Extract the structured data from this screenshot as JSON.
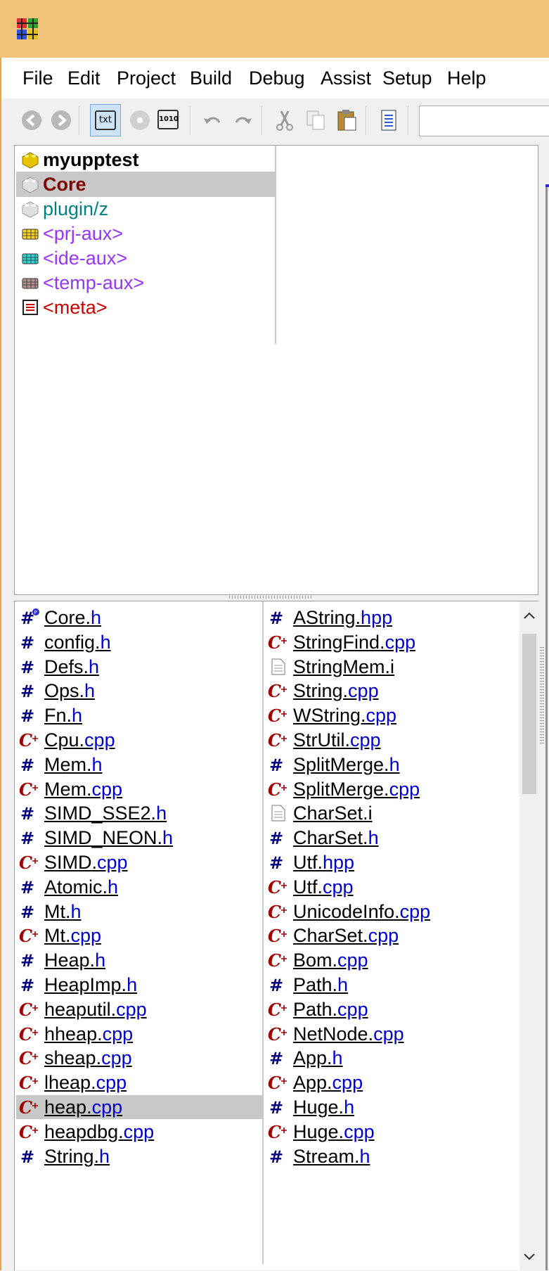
{
  "menu": [
    "File",
    "Edit",
    "Project",
    "Build",
    "Debug",
    "Assist",
    "Setup",
    "Help"
  ],
  "toolbar": {
    "icons": [
      "back-icon",
      "forward-icon",
      "txt-mode-icon",
      "cd-icon",
      "binary-mode-icon",
      "undo-icon",
      "redo-icon",
      "cut-icon",
      "copy-icon",
      "paste-icon",
      "document-icon"
    ],
    "txt_label": "txt",
    "bin_label": "1010"
  },
  "packages": [
    {
      "name": "myupptest",
      "kind": "main",
      "color": "#000000",
      "bold": true
    },
    {
      "name": "Core",
      "kind": "package",
      "color": "#800000",
      "bold": true,
      "selected": true
    },
    {
      "name": "plugin/z",
      "kind": "package",
      "color": "#008080",
      "bold": false
    },
    {
      "name": "<prj-aux>",
      "kind": "prj-aux",
      "color": "#9933ff",
      "bold": false
    },
    {
      "name": "<ide-aux>",
      "kind": "ide-aux",
      "color": "#9933ff",
      "bold": false
    },
    {
      "name": "<temp-aux>",
      "kind": "temp-aux",
      "color": "#9933ff",
      "bold": false
    },
    {
      "name": "<meta>",
      "kind": "meta",
      "color": "#cc0000",
      "bold": false
    }
  ],
  "files_left": [
    {
      "base": "Core.",
      "ext": "h",
      "icon": "header-main"
    },
    {
      "base": "config.",
      "ext": "h",
      "icon": "header"
    },
    {
      "base": "Defs.",
      "ext": "h",
      "icon": "header"
    },
    {
      "base": "Ops.",
      "ext": "h",
      "icon": "header"
    },
    {
      "base": "Fn.",
      "ext": "h",
      "icon": "header"
    },
    {
      "base": "Cpu.",
      "ext": "cpp",
      "icon": "cpp"
    },
    {
      "base": "Mem.",
      "ext": "h",
      "icon": "header"
    },
    {
      "base": "Mem.",
      "ext": "cpp",
      "icon": "cpp"
    },
    {
      "base": "SIMD_SSE2.",
      "ext": "h",
      "icon": "header"
    },
    {
      "base": "SIMD_NEON.",
      "ext": "h",
      "icon": "header"
    },
    {
      "base": "SIMD.",
      "ext": "cpp",
      "icon": "cpp"
    },
    {
      "base": "Atomic.",
      "ext": "h",
      "icon": "header"
    },
    {
      "base": "Mt.",
      "ext": "h",
      "icon": "header"
    },
    {
      "base": "Mt.",
      "ext": "cpp",
      "icon": "cpp"
    },
    {
      "base": "Heap.",
      "ext": "h",
      "icon": "header"
    },
    {
      "base": "HeapImp.",
      "ext": "h",
      "icon": "header"
    },
    {
      "base": "heaputil.",
      "ext": "cpp",
      "icon": "cpp"
    },
    {
      "base": "hheap.",
      "ext": "cpp",
      "icon": "cpp"
    },
    {
      "base": "sheap.",
      "ext": "cpp",
      "icon": "cpp"
    },
    {
      "base": "lheap.",
      "ext": "cpp",
      "icon": "cpp"
    },
    {
      "base": "heap.",
      "ext": "cpp",
      "icon": "cpp",
      "selected": true
    },
    {
      "base": "heapdbg.",
      "ext": "cpp",
      "icon": "cpp"
    },
    {
      "base": "String.",
      "ext": "h",
      "icon": "header"
    }
  ],
  "files_right": [
    {
      "base": "AString.",
      "ext": "hpp",
      "icon": "header"
    },
    {
      "base": "StringFind.",
      "ext": "cpp",
      "icon": "cpp"
    },
    {
      "base": "StringMem.",
      "ext": "i",
      "icon": "text"
    },
    {
      "base": "String.",
      "ext": "cpp",
      "icon": "cpp"
    },
    {
      "base": "WString.",
      "ext": "cpp",
      "icon": "cpp"
    },
    {
      "base": "StrUtil.",
      "ext": "cpp",
      "icon": "cpp"
    },
    {
      "base": "SplitMerge.",
      "ext": "h",
      "icon": "header"
    },
    {
      "base": "SplitMerge.",
      "ext": "cpp",
      "icon": "cpp"
    },
    {
      "base": "CharSet.",
      "ext": "i",
      "icon": "text"
    },
    {
      "base": "CharSet.",
      "ext": "h",
      "icon": "header"
    },
    {
      "base": "Utf.",
      "ext": "hpp",
      "icon": "header"
    },
    {
      "base": "Utf.",
      "ext": "cpp",
      "icon": "cpp"
    },
    {
      "base": "UnicodeInfo.",
      "ext": "cpp",
      "icon": "cpp"
    },
    {
      "base": "CharSet.",
      "ext": "cpp",
      "icon": "cpp"
    },
    {
      "base": "Bom.",
      "ext": "cpp",
      "icon": "cpp"
    },
    {
      "base": "Path.",
      "ext": "h",
      "icon": "header"
    },
    {
      "base": "Path.",
      "ext": "cpp",
      "icon": "cpp"
    },
    {
      "base": "NetNode.",
      "ext": "cpp",
      "icon": "cpp"
    },
    {
      "base": "App.",
      "ext": "h",
      "icon": "header"
    },
    {
      "base": "App.",
      "ext": "cpp",
      "icon": "cpp"
    },
    {
      "base": "Huge.",
      "ext": "h",
      "icon": "header"
    },
    {
      "base": "Huge.",
      "ext": "cpp",
      "icon": "cpp"
    },
    {
      "base": "Stream.",
      "ext": "h",
      "icon": "header"
    }
  ],
  "colors": {
    "titlebar": "#f0c27a",
    "selection": "#c8c8c8",
    "ext": "#0000d0",
    "header_icon": "#000080",
    "cpp_icon": "#a00000"
  }
}
